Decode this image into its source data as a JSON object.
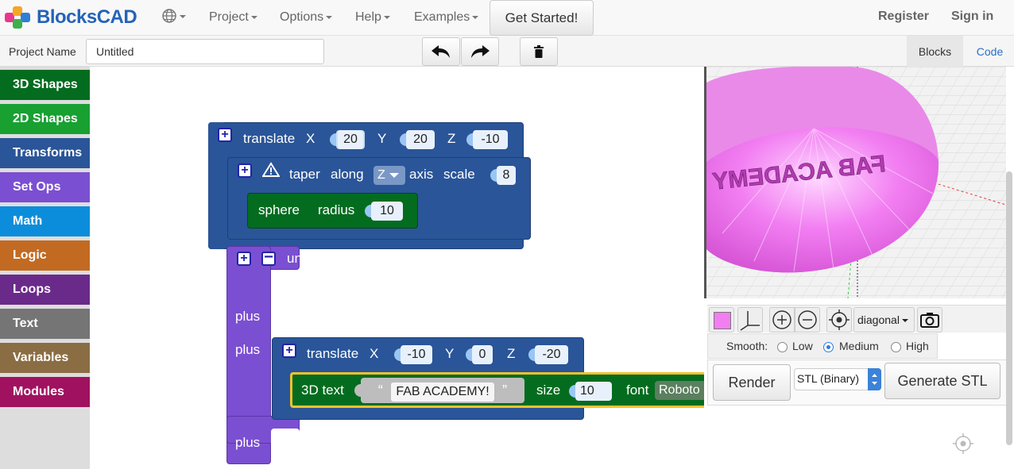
{
  "navbar": {
    "brand": "BlocksCAD",
    "menus": [
      "Project",
      "Options",
      "Help",
      "Examples"
    ],
    "get_started": "Get Started!",
    "register": "Register",
    "sign_in": "Sign in"
  },
  "projectbar": {
    "label": "Project Name",
    "name_value": "Untitled",
    "tabs": [
      "Blocks",
      "Code"
    ],
    "active_tab": "Blocks"
  },
  "toolbox": {
    "categories": [
      {
        "label": "3D Shapes",
        "color": "#046c1f"
      },
      {
        "label": "2D Shapes",
        "color": "#18a031"
      },
      {
        "label": "Transforms",
        "color": "#2a5598"
      },
      {
        "label": "Set Ops",
        "color": "#7b4fd1"
      },
      {
        "label": "Math",
        "color": "#0c8ddb"
      },
      {
        "label": "Logic",
        "color": "#c26a22"
      },
      {
        "label": "Loops",
        "color": "#6a2a8a"
      },
      {
        "label": "Text",
        "color": "#757575"
      },
      {
        "label": "Variables",
        "color": "#8b6d44"
      },
      {
        "label": "Modules",
        "color": "#a0125f"
      }
    ]
  },
  "blocks": {
    "translate1": {
      "label": "translate",
      "x_label": "X",
      "x": "20",
      "y_label": "Y",
      "y": "20",
      "z_label": "Z",
      "z": "-10"
    },
    "taper": {
      "label": "taper",
      "along": "along",
      "axis_value": "Z",
      "axis": "axis",
      "scale": "scale",
      "scale_value": "8"
    },
    "sphere": {
      "label": "sphere",
      "radius": "radius",
      "radius_value": "10"
    },
    "union": {
      "label": "union",
      "plus": "plus"
    },
    "translate2": {
      "label": "translate",
      "x_label": "X",
      "x": "-10",
      "y_label": "Y",
      "y": "0",
      "z_label": "Z",
      "z": "-20"
    },
    "text3d": {
      "label": "3D text",
      "open_quote": "“",
      "text": "FAB ACADEMY!",
      "close_quote": "”",
      "size": "size",
      "size_value": "10",
      "font": "font",
      "font_value": "Roboto"
    }
  },
  "viewer": {
    "model_text": "FAB ACADEMY",
    "model_color": "#f27ef2",
    "view_option": "diagonal",
    "smooth_label": "Smooth:",
    "smooth_options": [
      "Low",
      "Medium",
      "High"
    ],
    "smooth_selected": "Medium",
    "render": "Render",
    "format": "STL (Binary)",
    "generate": "Generate STL"
  }
}
